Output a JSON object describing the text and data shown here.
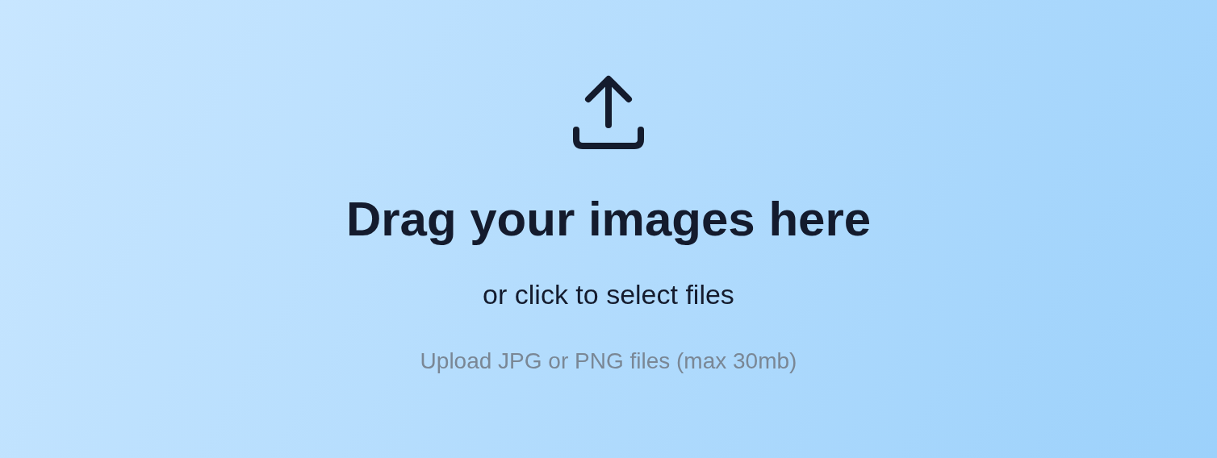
{
  "heading": "Drag your images here",
  "subheading": "or click to select files",
  "hint": "Upload JPG or PNG files (max 30mb)"
}
